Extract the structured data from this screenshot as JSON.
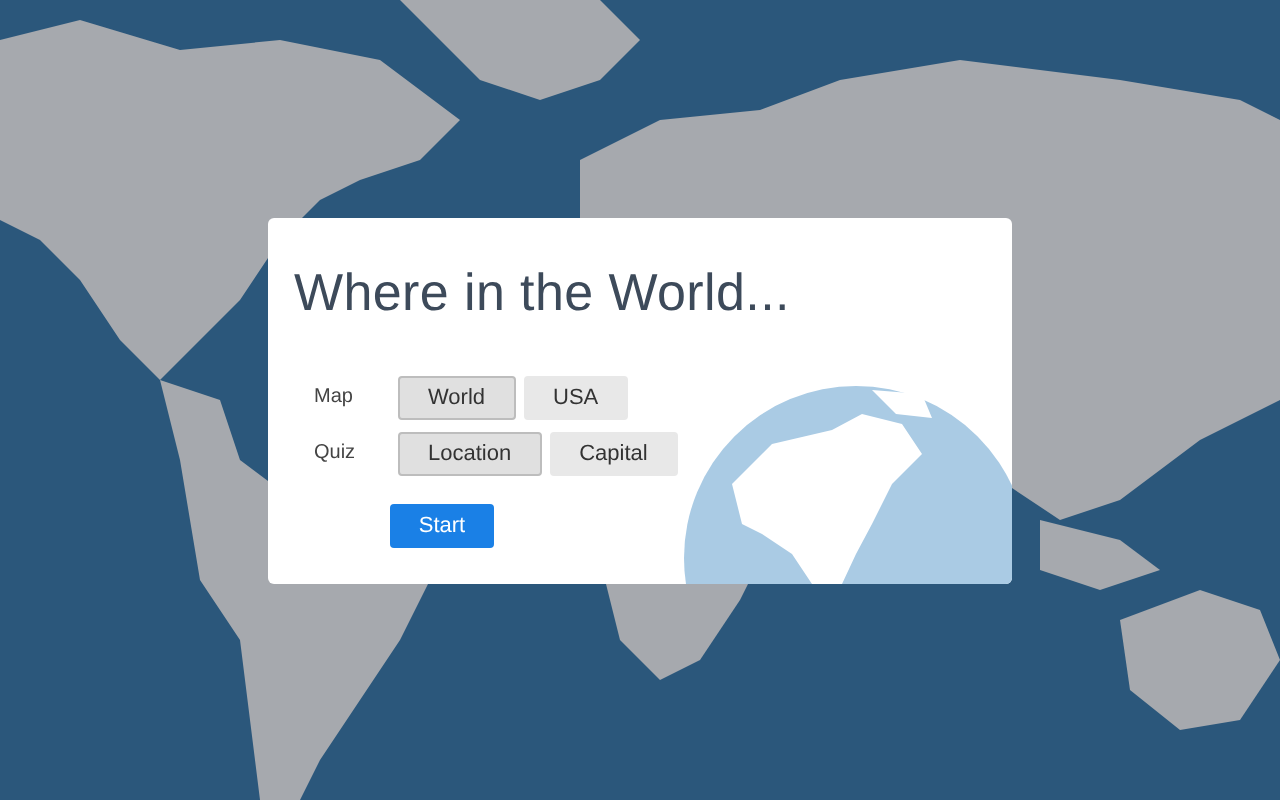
{
  "title": "Where in the World...",
  "options": [
    {
      "label": "Map",
      "choices": [
        {
          "label": "World",
          "selected": true
        },
        {
          "label": "USA",
          "selected": false
        }
      ]
    },
    {
      "label": "Quiz",
      "choices": [
        {
          "label": "Location",
          "selected": true
        },
        {
          "label": "Capital",
          "selected": false
        }
      ]
    }
  ],
  "start_button": "Start"
}
